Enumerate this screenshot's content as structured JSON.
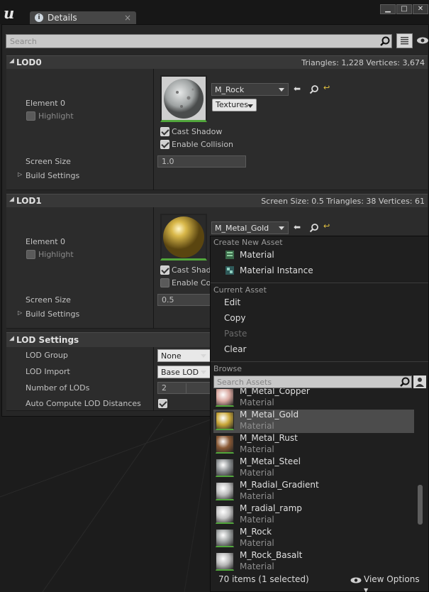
{
  "window": {
    "tab_title": "Details",
    "tab_close": "×",
    "minimize": "▁",
    "maximize": "□",
    "close": "✕"
  },
  "search": {
    "placeholder": "Search"
  },
  "lod0": {
    "header": "LOD0",
    "stats": "Triangles: 1,228    Vertices: 3,674",
    "element": "Element 0",
    "highlight": "Highlight",
    "material": "M_Rock",
    "textures": "Textures",
    "cast_shadow": "Cast Shadow",
    "enable_collision": "Enable Collision",
    "screen_size_label": "Screen Size",
    "screen_size_value": "1.0",
    "build_settings": "Build Settings"
  },
  "lod1": {
    "header": "LOD1",
    "stats": "Screen Size: 0.5    Triangles: 38    Vertices: 61",
    "element": "Element 0",
    "highlight": "Highlight",
    "material": "M_Metal_Gold",
    "cast_shadow": "Cast Shadow",
    "enable_collision": "Enable Collision",
    "screen_size_label": "Screen Size",
    "screen_size_value": "0.5",
    "build_settings": "Build Settings"
  },
  "lod_settings": {
    "header": "LOD Settings",
    "lod_group_label": "LOD Group",
    "lod_group_value": "None",
    "lod_import_label": "LOD Import",
    "lod_import_value": "Base LOD",
    "num_lods_label": "Number of LODs",
    "num_lods_value": "2",
    "auto_compute_label": "Auto Compute LOD Distances",
    "auto_compute_checked": true
  },
  "menu": {
    "create_new_asset": "Create New Asset",
    "material": "Material",
    "material_instance": "Material Instance",
    "current_asset": "Current Asset",
    "edit": "Edit",
    "copy": "Copy",
    "paste": "Paste",
    "clear": "Clear",
    "browse": "Browse",
    "search_placeholder": "Search Assets",
    "footer_count": "70 items (1 selected)",
    "view_options": "View Options"
  },
  "assets": [
    {
      "name": "M_Metal_Copper",
      "type": "Material",
      "swatch": "#d9a8a0",
      "selected": false
    },
    {
      "name": "M_Metal_Gold",
      "type": "Material",
      "swatch": "#c9a73a",
      "selected": true
    },
    {
      "name": "M_Metal_Rust",
      "type": "Material",
      "swatch": "#8a5a36",
      "selected": false
    },
    {
      "name": "M_Metal_Steel",
      "type": "Material",
      "swatch": "#8c9092",
      "selected": false
    },
    {
      "name": "M_Radial_Gradient",
      "type": "Material",
      "swatch": "#bdbdbd",
      "selected": false
    },
    {
      "name": "M_radial_ramp",
      "type": "Material",
      "swatch": "#c4c4c4",
      "selected": false
    },
    {
      "name": "M_Rock",
      "type": "Material",
      "swatch": "#9fa3a3",
      "selected": false
    },
    {
      "name": "M_Rock_Basalt",
      "type": "Material",
      "swatch": "#b8b8b8",
      "selected": false
    }
  ],
  "colors": {
    "accent_green": "#51a63b",
    "selected_row": "#4c4c4c",
    "hyperlink_yellow": "#e8c640"
  }
}
